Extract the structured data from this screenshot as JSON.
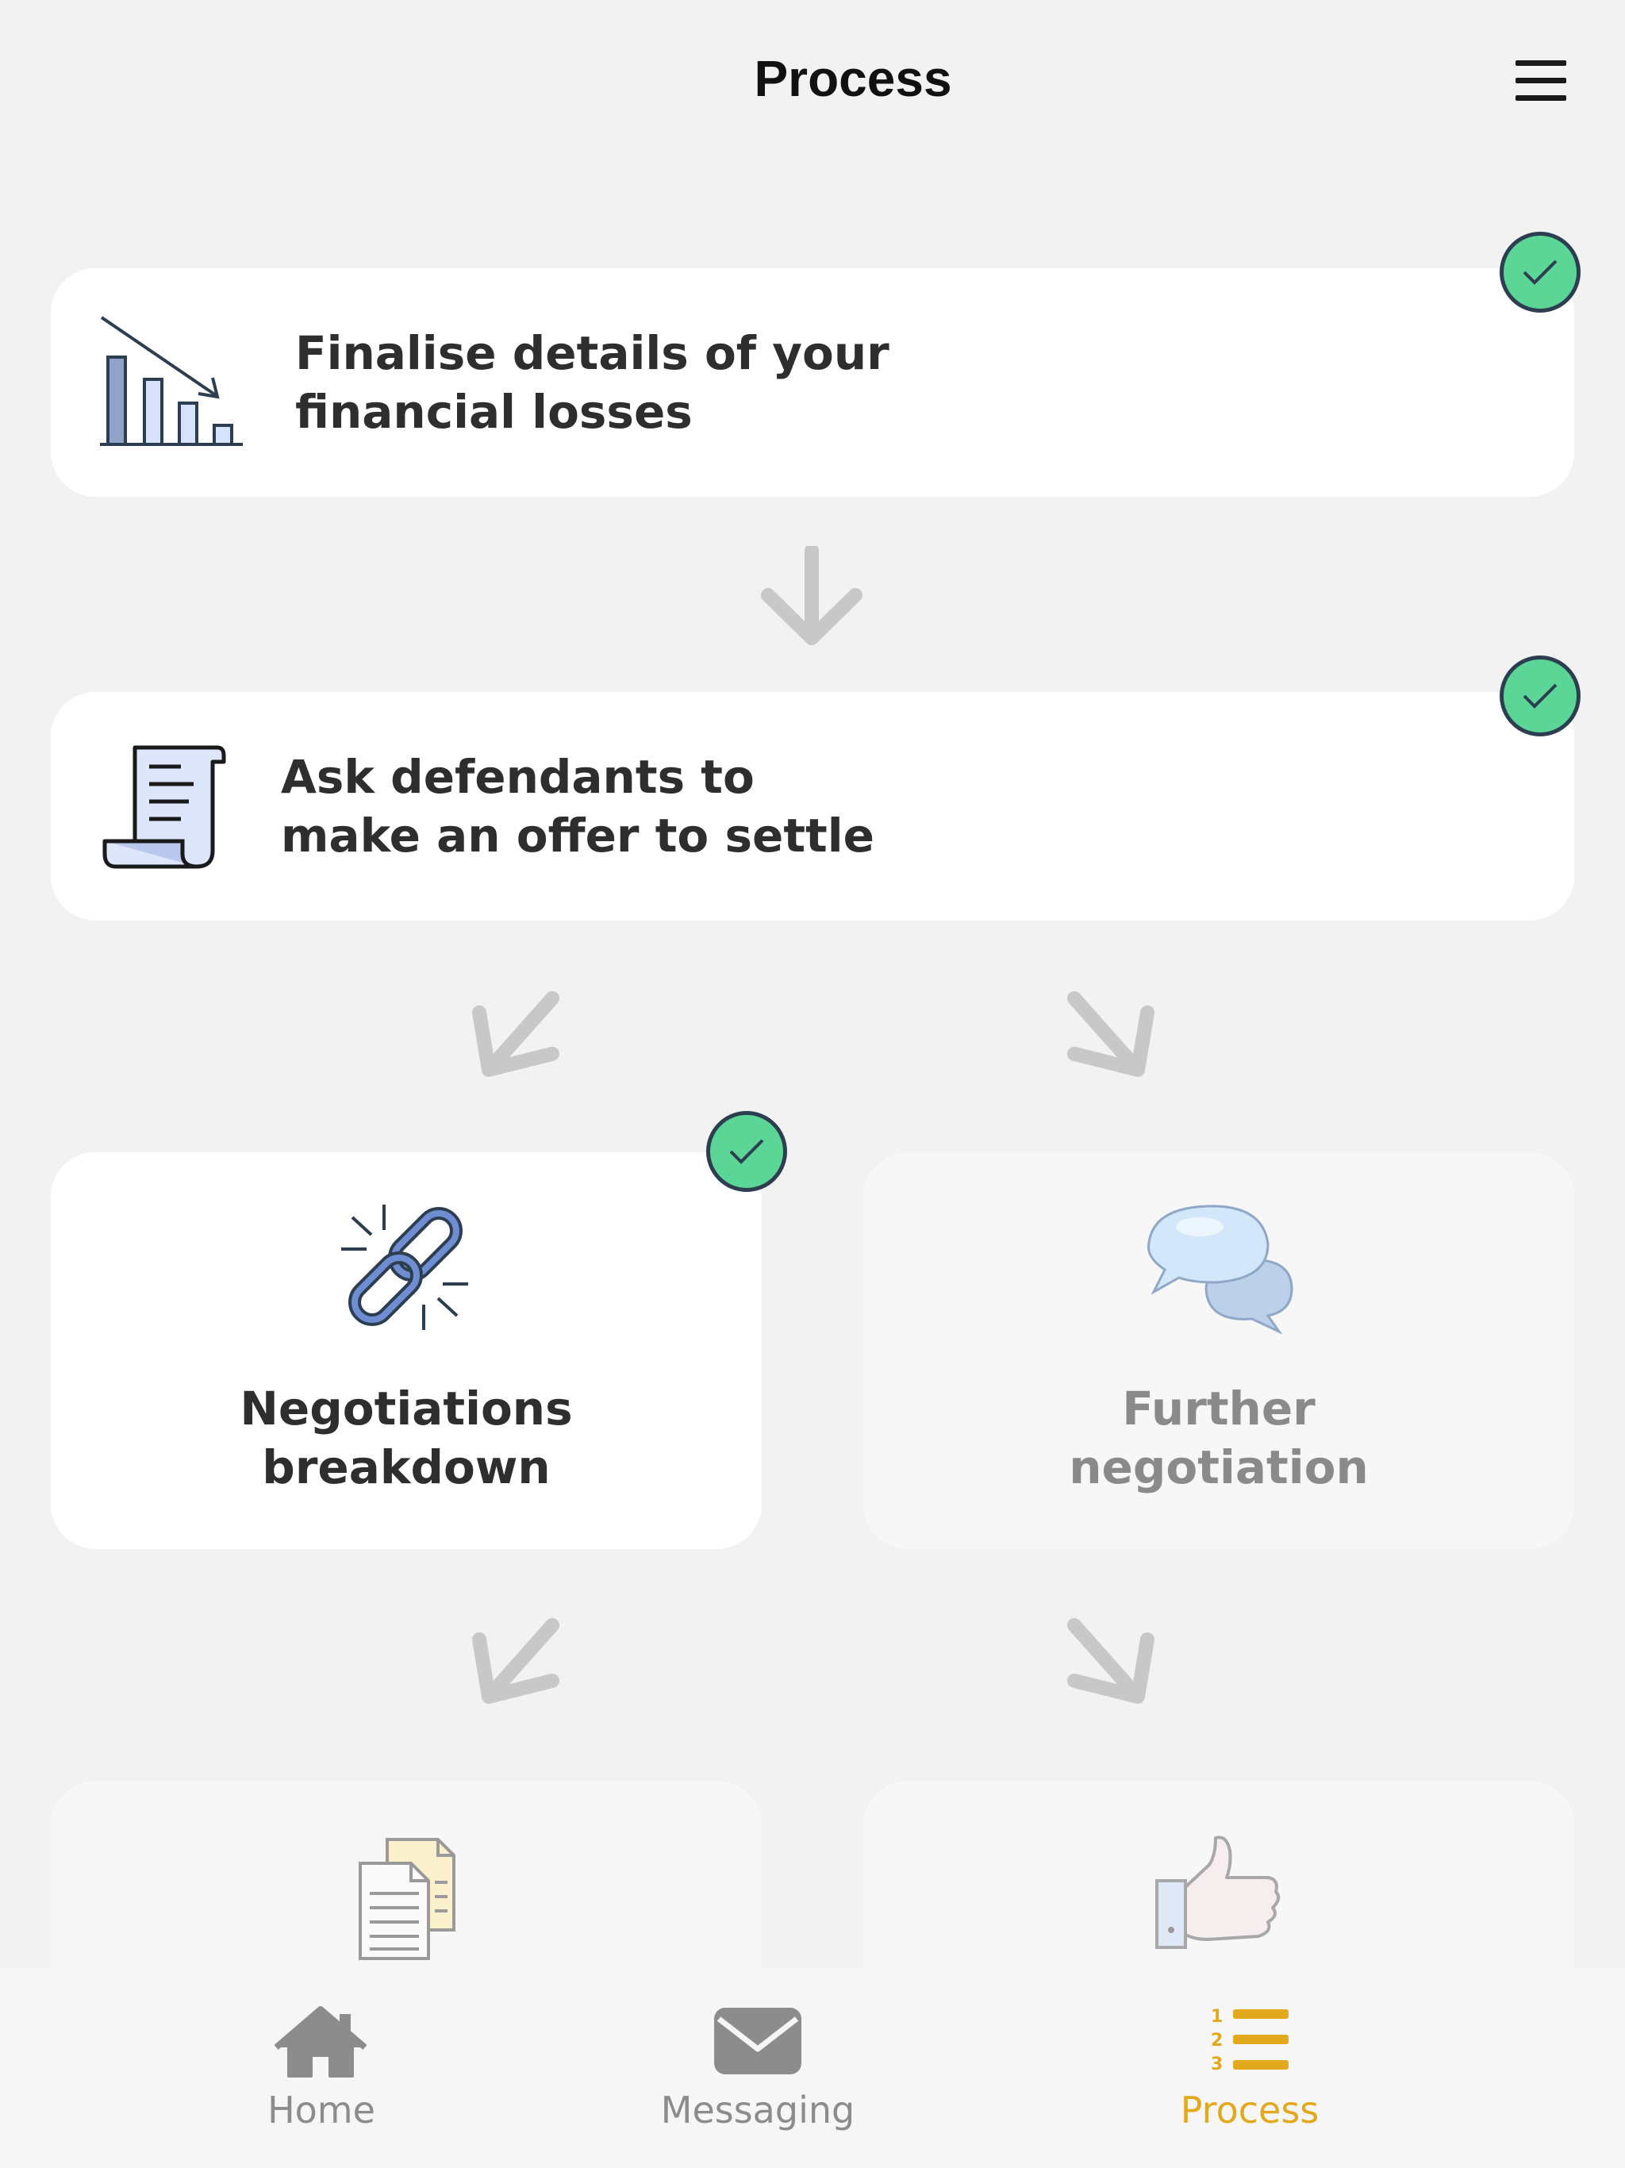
{
  "header": {
    "title": "Process",
    "menu_icon": "hamburger-menu-icon"
  },
  "steps": {
    "financial_losses": {
      "line1": "Finalise details of your",
      "line2": "financial losses",
      "icon": "declining-bar-chart-icon",
      "completed": true
    },
    "ask_offer": {
      "line1": "Ask defendants to",
      "line2": "make an offer to settle",
      "icon": "scroll-document-icon",
      "completed": true
    },
    "negotiations_breakdown": {
      "line1": "Negotiations",
      "line2": "breakdown",
      "icon": "broken-chain-link-icon",
      "completed": true
    },
    "further_negotiation": {
      "line1": "Further",
      "line2": "negotiation",
      "icon": "speech-bubbles-icon",
      "completed": false
    },
    "documents_step": {
      "icon": "documents-icon",
      "completed": false
    },
    "thumbs_up_step": {
      "icon": "thumbs-up-icon",
      "completed": false
    }
  },
  "tabs": [
    {
      "label": "Home",
      "icon": "home-icon",
      "active": false
    },
    {
      "label": "Messaging",
      "icon": "envelope-icon",
      "active": false
    },
    {
      "label": "Process",
      "icon": "numbered-list-icon",
      "active": true
    }
  ],
  "colors": {
    "check": "#5cd696",
    "active_tab": "#e3a91c",
    "inactive_tab": "#8c8c8c",
    "arrow": "#c8c8c8"
  }
}
